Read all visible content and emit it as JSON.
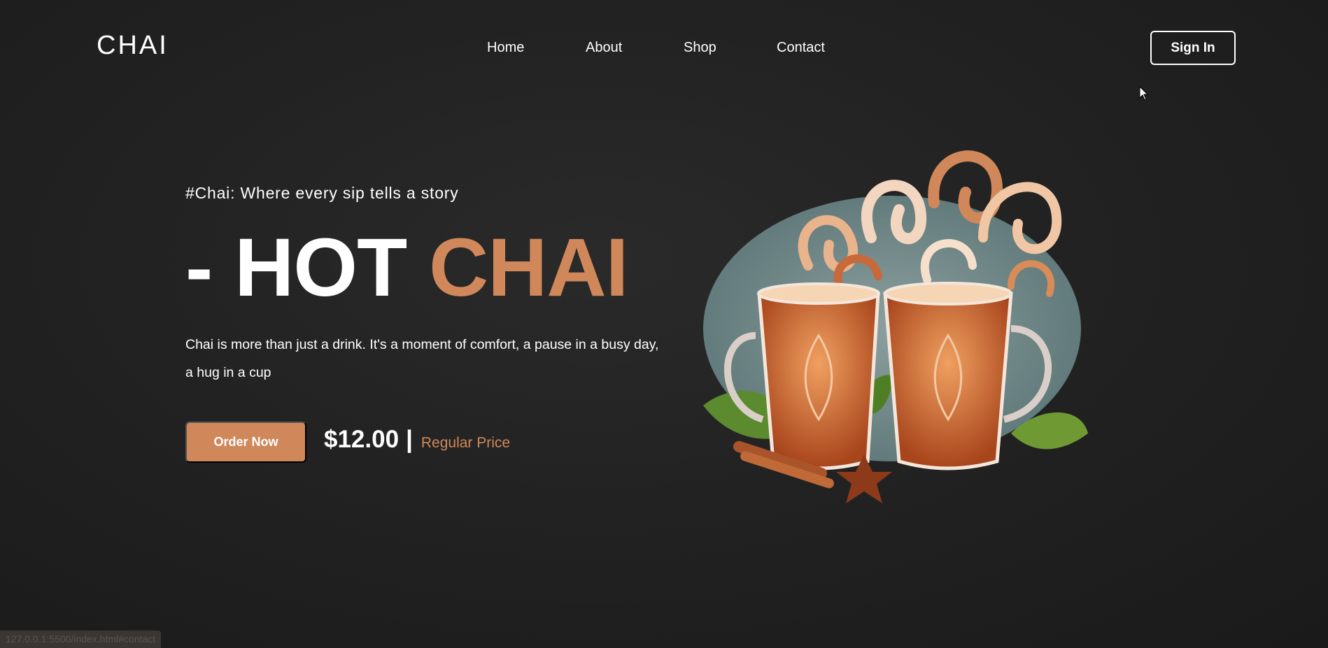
{
  "brand": {
    "logo": "CHAI",
    "accent_color": "#d0885a"
  },
  "nav": {
    "home": "Home",
    "about": "About",
    "shop": "Shop",
    "contact": "Contact"
  },
  "header": {
    "signin_label": "Sign In"
  },
  "hero": {
    "tagline": "#Chai: Where every sip tells a story",
    "headline_prefix": "- HOT",
    "headline_accent": "CHAI",
    "description": "Chai is more than just a drink. It's a moment of comfort, a pause in a busy day, a hug in a cup",
    "order_label": "Order Now",
    "price": "$12.00",
    "price_separator": "|",
    "price_label": "Regular Price"
  },
  "status_bar": {
    "url": "127.0.0.1:5500/index.html#contact"
  }
}
